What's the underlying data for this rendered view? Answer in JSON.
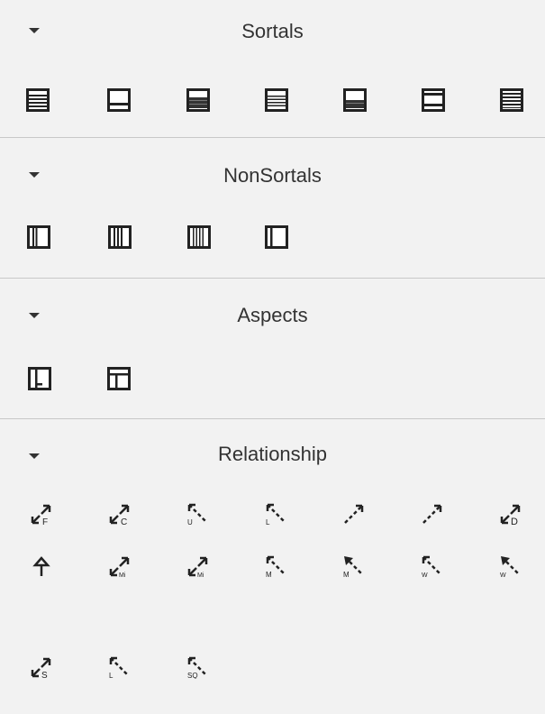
{
  "sections": {
    "sortals": {
      "title": "Sortals",
      "icons": [
        "sortal-kind-icon",
        "sortal-subkind-icon",
        "sortal-phase-icon",
        "sortal-role-icon",
        "sortal-quantity-icon",
        "sortal-collective-icon",
        "sortal-relator-icon"
      ]
    },
    "nonsortals": {
      "title": "NonSortals",
      "icons": [
        "category-icon",
        "mixin-icon",
        "rolemixin-icon",
        "phasemixin-icon"
      ]
    },
    "aspects": {
      "title": "Aspects",
      "icons": [
        "mode-icon",
        "quality-icon"
      ]
    },
    "relationship": {
      "title": "Relationship",
      "row1_labels": [
        "F",
        "C",
        "U",
        "L",
        "",
        "",
        "D"
      ],
      "row2_labels": [
        "",
        "Mi",
        "Mi",
        "M",
        "M",
        "W",
        "W"
      ],
      "row3_labels": [
        "S",
        "L",
        "SQ"
      ]
    }
  }
}
